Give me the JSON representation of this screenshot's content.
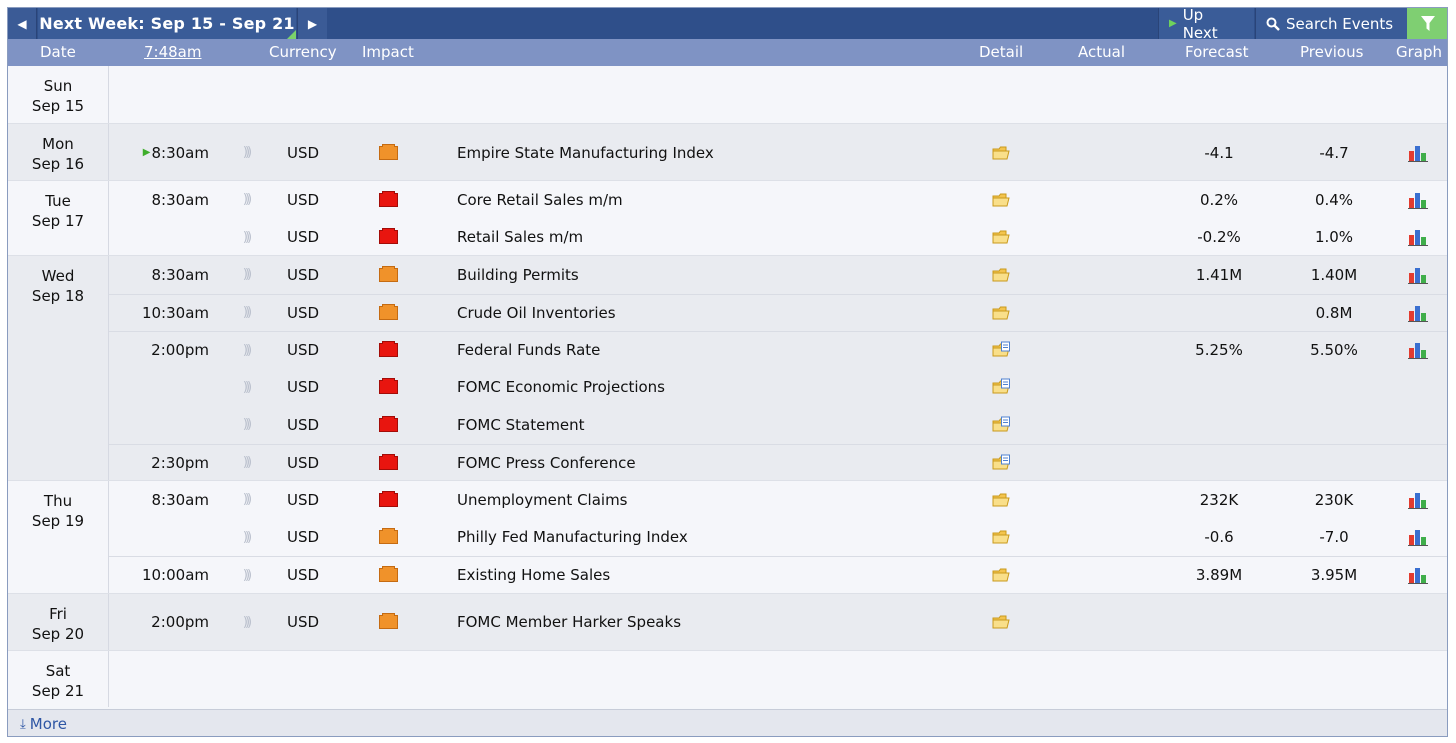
{
  "topbar": {
    "week_label": "Next Week: Sep 15 - Sep 21",
    "up_next_label": "Up Next",
    "search_label": "Search Events"
  },
  "header": {
    "date": "Date",
    "time": "7:48am",
    "currency": "Currency",
    "impact": "Impact",
    "detail": "Detail",
    "actual": "Actual",
    "forecast": "Forecast",
    "previous": "Previous",
    "graph": "Graph"
  },
  "days": [
    {
      "dow": "Sun",
      "date": "Sep 15",
      "events": []
    },
    {
      "dow": "Mon",
      "date": "Sep 16",
      "events": [
        {
          "time": "8:30am",
          "currency": "USD",
          "impact": "orange",
          "name": "Empire State Manufacturing Index",
          "detail": "folder",
          "forecast": "-4.1",
          "previous": "-4.7",
          "graph": true,
          "next": true
        }
      ]
    },
    {
      "dow": "Tue",
      "date": "Sep 17",
      "events": [
        {
          "time": "8:30am",
          "currency": "USD",
          "impact": "red",
          "name": "Core Retail Sales m/m",
          "detail": "folder",
          "forecast": "0.2%",
          "previous": "0.4%",
          "graph": true
        },
        {
          "time": "",
          "currency": "USD",
          "impact": "red",
          "name": "Retail Sales m/m",
          "detail": "folder",
          "forecast": "-0.2%",
          "previous": "1.0%",
          "graph": true
        }
      ]
    },
    {
      "dow": "Wed",
      "date": "Sep 18",
      "events": [
        {
          "time": "8:30am",
          "currency": "USD",
          "impact": "orange",
          "name": "Building Permits",
          "detail": "folder",
          "forecast": "1.41M",
          "previous": "1.40M",
          "graph": true
        },
        {
          "time": "10:30am",
          "currency": "USD",
          "impact": "orange",
          "name": "Crude Oil Inventories",
          "detail": "folder",
          "forecast": "",
          "previous": "0.8M",
          "graph": true
        },
        {
          "time": "2:00pm",
          "currency": "USD",
          "impact": "red",
          "name": "Federal Funds Rate",
          "detail": "folder-doc",
          "forecast": "5.25%",
          "previous": "5.50%",
          "graph": true
        },
        {
          "time": "",
          "currency": "USD",
          "impact": "red",
          "name": "FOMC Economic Projections",
          "detail": "folder-doc",
          "forecast": "",
          "previous": "",
          "graph": false
        },
        {
          "time": "",
          "currency": "USD",
          "impact": "red",
          "name": "FOMC Statement",
          "detail": "folder-doc",
          "forecast": "",
          "previous": "",
          "graph": false
        },
        {
          "time": "2:30pm",
          "currency": "USD",
          "impact": "red",
          "name": "FOMC Press Conference",
          "detail": "folder-doc",
          "forecast": "",
          "previous": "",
          "graph": false
        }
      ]
    },
    {
      "dow": "Thu",
      "date": "Sep 19",
      "events": [
        {
          "time": "8:30am",
          "currency": "USD",
          "impact": "red",
          "name": "Unemployment Claims",
          "detail": "folder",
          "forecast": "232K",
          "previous": "230K",
          "graph": true
        },
        {
          "time": "",
          "currency": "USD",
          "impact": "orange",
          "name": "Philly Fed Manufacturing Index",
          "detail": "folder",
          "forecast": "-0.6",
          "previous": "-7.0",
          "graph": true
        },
        {
          "time": "10:00am",
          "currency": "USD",
          "impact": "orange",
          "name": "Existing Home Sales",
          "detail": "folder",
          "forecast": "3.89M",
          "previous": "3.95M",
          "graph": true
        }
      ]
    },
    {
      "dow": "Fri",
      "date": "Sep 20",
      "events": [
        {
          "time": "2:00pm",
          "currency": "USD",
          "impact": "orange",
          "name": "FOMC Member Harker Speaks",
          "detail": "folder",
          "forecast": "",
          "previous": "",
          "graph": false
        }
      ]
    },
    {
      "dow": "Sat",
      "date": "Sep 21",
      "events": []
    }
  ],
  "footer": {
    "more_label": "More"
  },
  "colors": {
    "topbar": "#2f4f8a",
    "header": "#7f93c4",
    "impact_high": "#e8150f",
    "impact_medium": "#f0922a",
    "filter": "#7fcf72"
  }
}
